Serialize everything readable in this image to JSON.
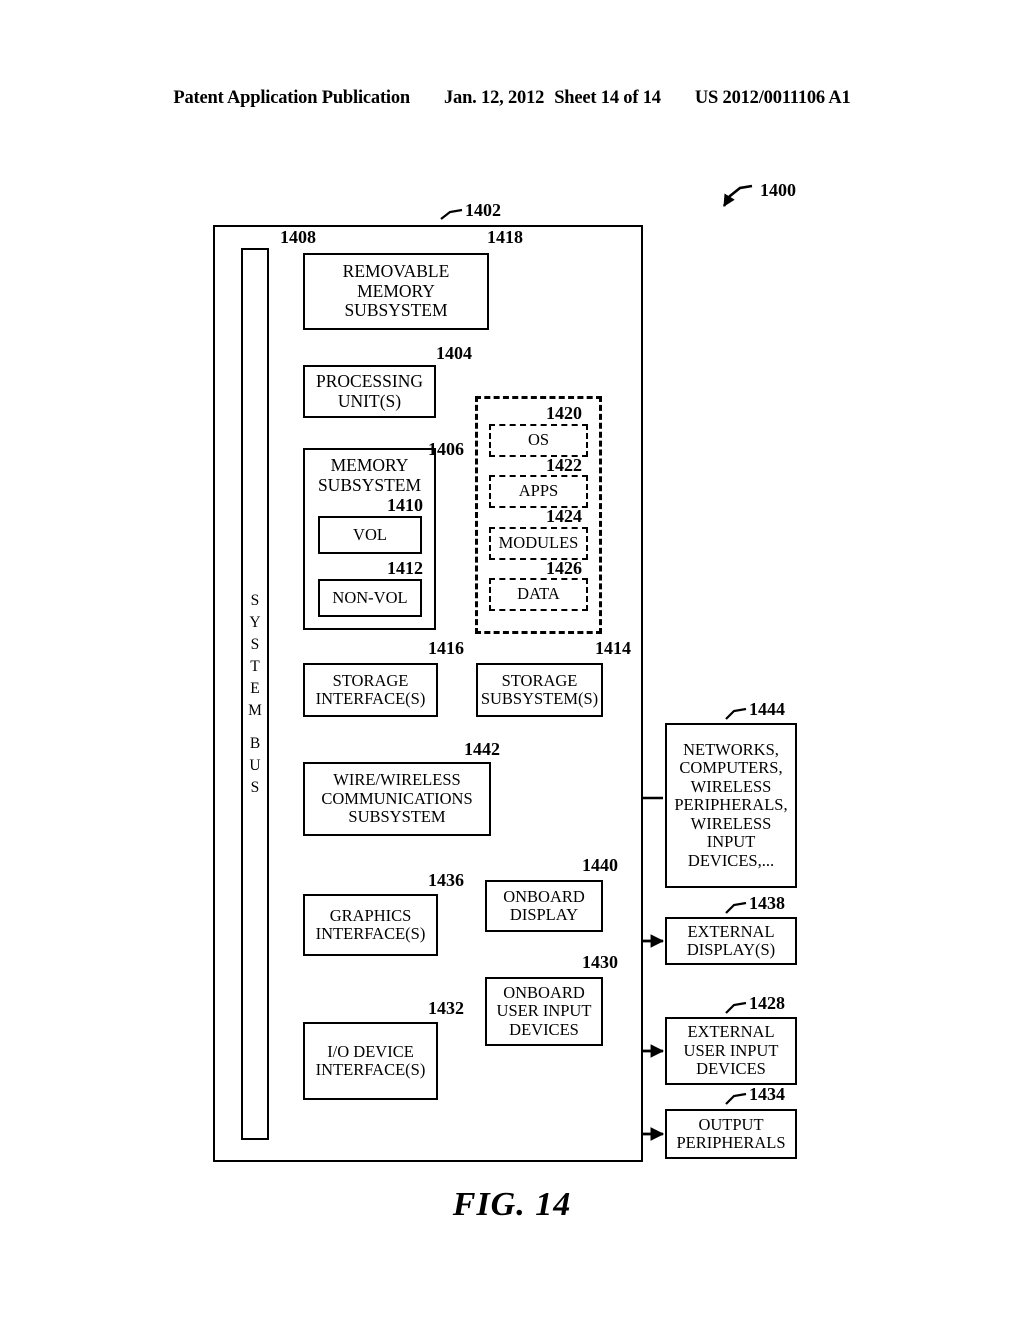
{
  "page_header": {
    "left": "Patent Application Publication",
    "date": "Jan. 12, 2012",
    "sheet": "Sheet 14 of 14",
    "pub_number": "US 2012/0011106 A1"
  },
  "figure": {
    "caption": "FIG. 14",
    "overall_ref": "1400"
  },
  "diagram": {
    "outer_container": {
      "ref": "1402"
    },
    "system_bus": {
      "ref": "1408",
      "label": "SYSTEM BUS"
    },
    "blocks": [
      {
        "id": "removable-memory-subsystem",
        "ref": "1418",
        "label": "REMOVABLE MEMORY SUBSYSTEM"
      },
      {
        "id": "processing-units",
        "ref": "1404",
        "label": "PROCESSING UNIT(S)"
      },
      {
        "id": "memory-subsystem",
        "ref": "1406",
        "label": "MEMORY SUBSYSTEM"
      },
      {
        "id": "vol",
        "ref": "1410",
        "label": "VOL"
      },
      {
        "id": "non-vol",
        "ref": "1412",
        "label": "NON-VOL"
      },
      {
        "id": "os",
        "ref": "1420",
        "label": "OS"
      },
      {
        "id": "apps",
        "ref": "1422",
        "label": "APPS"
      },
      {
        "id": "modules",
        "ref": "1424",
        "label": "MODULES"
      },
      {
        "id": "data",
        "ref": "1426",
        "label": "DATA"
      },
      {
        "id": "storage-interfaces",
        "ref": "1416",
        "label": "STORAGE INTERFACE(S)"
      },
      {
        "id": "storage-subsystems",
        "ref": "1414",
        "label": "STORAGE SUBSYSTEM(S)"
      },
      {
        "id": "wire-wireless-comms",
        "ref": "1442",
        "label": "WIRE/WIRELESS COMMUNICATIONS SUBSYSTEM"
      },
      {
        "id": "networks-computers",
        "ref": "1444",
        "label": "NETWORKS, COMPUTERS, WIRELESS PERIPHERALS, WIRELESS INPUT DEVICES,..."
      },
      {
        "id": "graphics-interfaces",
        "ref": "1436",
        "label": "GRAPHICS INTERFACE(S)"
      },
      {
        "id": "onboard-display",
        "ref": "1440",
        "label": "ONBOARD DISPLAY"
      },
      {
        "id": "external-displays",
        "ref": "1438",
        "label": "EXTERNAL DISPLAY(S)"
      },
      {
        "id": "io-device-interfaces",
        "ref": "1432",
        "label": "I/O DEVICE INTERFACE(S)"
      },
      {
        "id": "onboard-user-input-devices",
        "ref": "1430",
        "label": "ONBOARD USER INPUT DEVICES"
      },
      {
        "id": "external-user-input-devices",
        "ref": "1428",
        "label": "EXTERNAL USER INPUT DEVICES"
      },
      {
        "id": "output-peripherals",
        "ref": "1434",
        "label": "OUTPUT PERIPHERALS"
      }
    ]
  }
}
